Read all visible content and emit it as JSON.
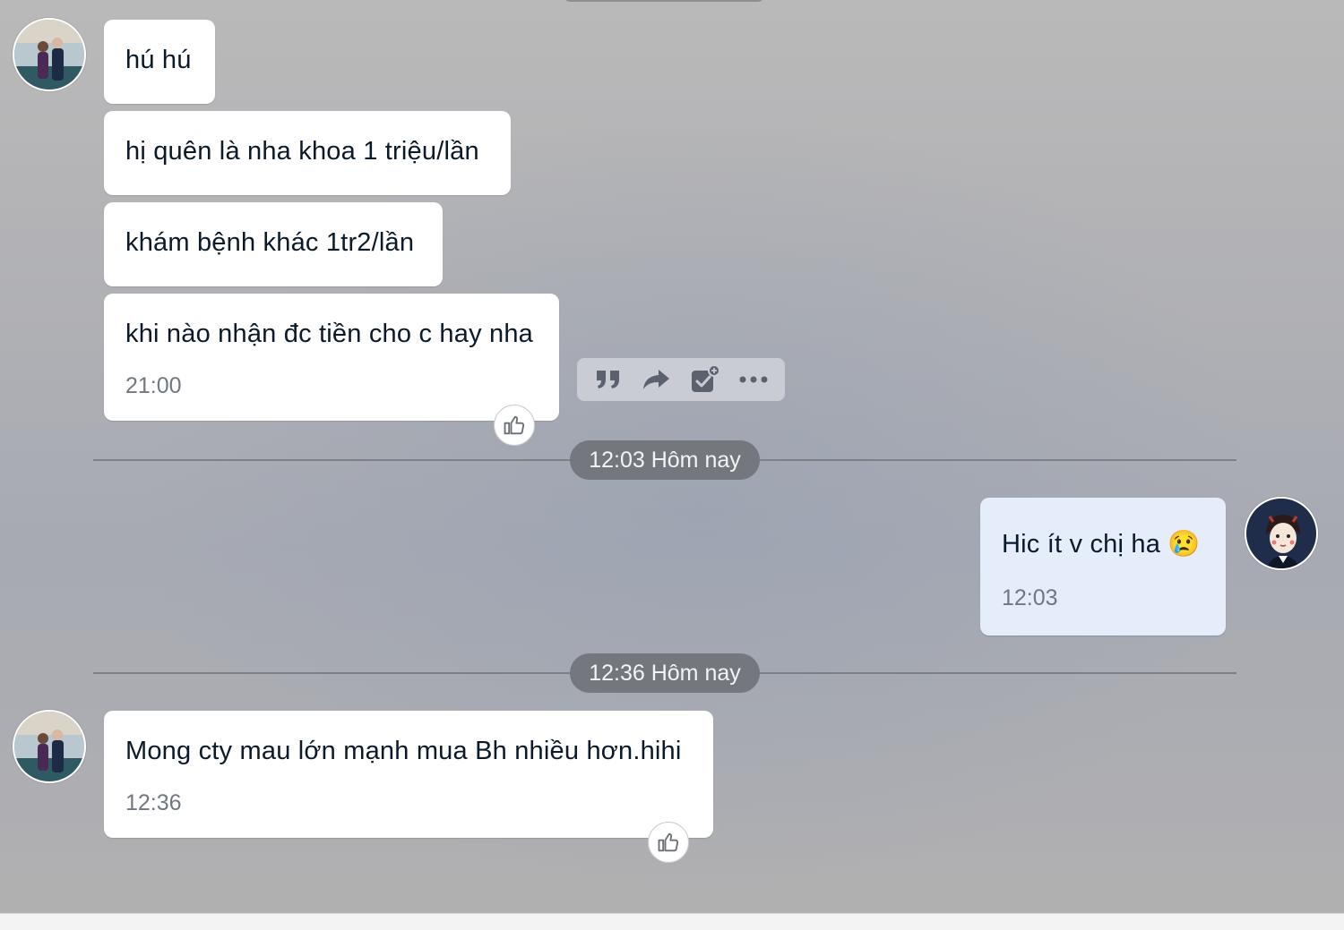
{
  "messages": [
    {
      "id": "m1",
      "text": "hú hú"
    },
    {
      "id": "m2",
      "text": "hị quên là nha khoa 1 triệu/lần"
    },
    {
      "id": "m3",
      "text": "khám bệnh khác 1tr2/lần"
    },
    {
      "id": "m4",
      "text": "khi nào nhận đc tiền cho c hay nha",
      "time": "21:00"
    },
    {
      "id": "m5",
      "text": "Hic ít v chị ha 😢",
      "time": "12:03"
    },
    {
      "id": "m6",
      "text": "Mong cty mau lớn mạnh mua Bh nhiều hơn.hihi",
      "time": "12:36"
    }
  ],
  "dividers": [
    {
      "label": "12:03 Hôm nay"
    },
    {
      "label": "12:36 Hôm nay"
    }
  ],
  "toolbar": {
    "icons": [
      "quote-icon",
      "forward-icon",
      "task-add-icon",
      "more-icon"
    ]
  },
  "colors": {
    "my_bubble": "#e5edfb",
    "their_bubble": "#ffffff",
    "divider_pill": "#74777e"
  }
}
